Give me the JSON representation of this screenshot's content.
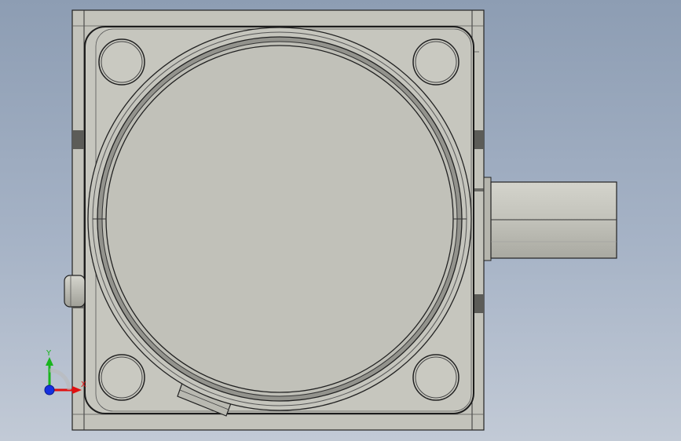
{
  "viewport": {
    "background_top": "#8d9db3",
    "background_bottom": "#c2cad6"
  },
  "model": {
    "body_color": "#c4c4bc",
    "face_color": "#c7c7bf",
    "edge_color": "#1a1a1a",
    "shaft_color": "#bfbfb7"
  },
  "triad": {
    "x_label": "X",
    "y_label": "Y",
    "x_color": "#e01010",
    "y_color": "#19b51d",
    "z_color": "#1530e0"
  }
}
